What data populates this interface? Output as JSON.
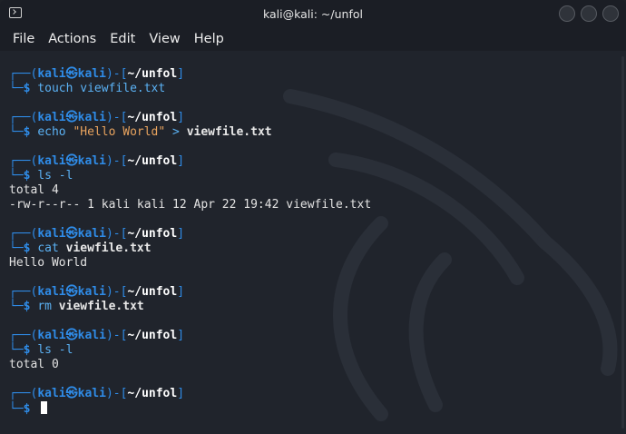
{
  "window": {
    "title": "kali@kali: ~/unfol"
  },
  "menu": [
    "File",
    "Actions",
    "Edit",
    "View",
    "Help"
  ],
  "prompt": {
    "user": "kali",
    "host": "kali",
    "at": "㉿",
    "path": "~/unfol",
    "symbol": "$"
  },
  "blocks": [
    {
      "cmd": "touch",
      "args": "viewfile.txt",
      "output": []
    },
    {
      "cmd": "echo",
      "str": "\"Hello World\"",
      "redir": ">",
      "args": "viewfile.txt",
      "output": []
    },
    {
      "cmd": "ls",
      "args": "-l",
      "output": [
        "total 4",
        "-rw-r--r-- 1 kali kali 12 Apr 22 19:42 viewfile.txt"
      ]
    },
    {
      "cmd": "cat",
      "args": "viewfile.txt",
      "output": [
        "Hello World"
      ]
    },
    {
      "cmd": "rm",
      "args": "viewfile.txt",
      "output": []
    },
    {
      "cmd": "ls",
      "args": "-l",
      "output": [
        "total 0"
      ]
    }
  ],
  "colors": {
    "prompt_blue": "#2f8ce8",
    "command": "#5bb2f5",
    "string": "#e8a35e",
    "background": "#20242c"
  }
}
